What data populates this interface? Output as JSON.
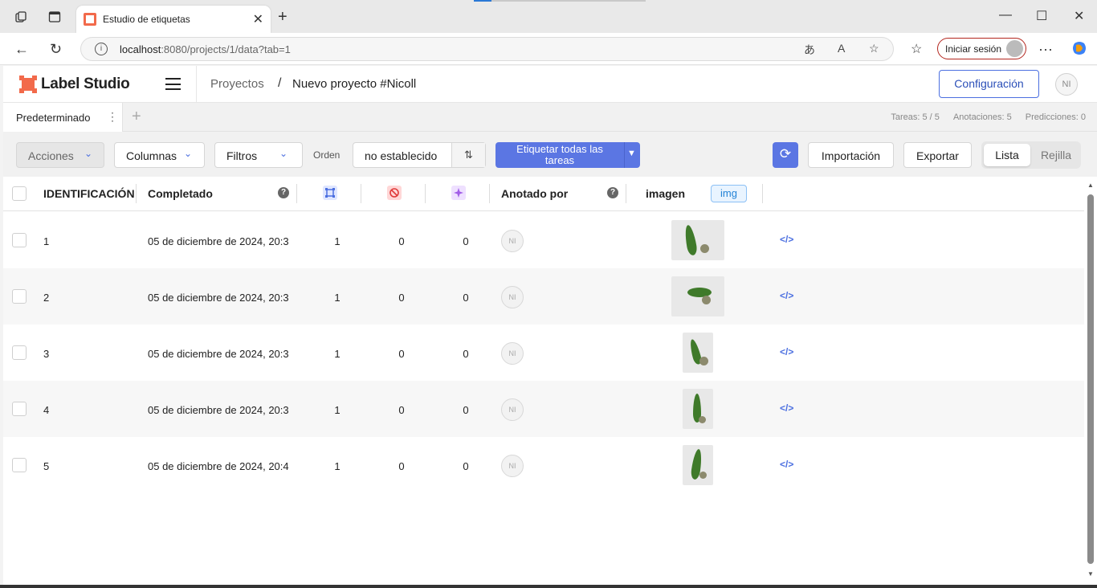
{
  "browser": {
    "tab_title": "Estudio de etiquetas",
    "url_host": "localhost",
    "url_rest": ":8080/projects/1/data?tab=1",
    "signin_label": "Iniciar sesión"
  },
  "app": {
    "logo": "Label Studio",
    "breadcrumb": [
      "Proyectos",
      "Nuevo proyecto #Nicoll"
    ],
    "config_label": "Configuración",
    "avatar_initials": "NI"
  },
  "tabs": {
    "default_tab": "Predeterminado",
    "stats": {
      "tasks": "Tareas: 5 / 5",
      "annotations": "Anotaciones: 5",
      "predictions": "Predicciones: 0"
    }
  },
  "toolbar": {
    "actions": "Acciones",
    "columns": "Columnas",
    "filters": "Filtros",
    "order_label": "Orden",
    "order_value": "no establecido",
    "label_all": "Etiquetar todas las tareas",
    "import": "Importación",
    "export": "Exportar",
    "view_list": "Lista",
    "view_grid": "Rejilla"
  },
  "table": {
    "headers": {
      "id": "IDENTIFICACIÓN",
      "completed": "Completado",
      "annotated_by": "Anotado por",
      "image": "imagen",
      "image_tag": "img"
    },
    "rows": [
      {
        "id": "1",
        "completed": "05 de diciembre de 2024, 20:3",
        "total": "1",
        "cancelled": "0",
        "predictions": "0",
        "annotator": "NI"
      },
      {
        "id": "2",
        "completed": "05 de diciembre de 2024, 20:3",
        "total": "1",
        "cancelled": "0",
        "predictions": "0",
        "annotator": "NI"
      },
      {
        "id": "3",
        "completed": "05 de diciembre de 2024, 20:3",
        "total": "1",
        "cancelled": "0",
        "predictions": "0",
        "annotator": "NI"
      },
      {
        "id": "4",
        "completed": "05 de diciembre de 2024, 20:3",
        "total": "1",
        "cancelled": "0",
        "predictions": "0",
        "annotator": "NI"
      },
      {
        "id": "5",
        "completed": "05 de diciembre de 2024, 20:4",
        "total": "1",
        "cancelled": "0",
        "predictions": "0",
        "annotator": "NI"
      }
    ]
  },
  "colors": {
    "accent": "#5b76e3",
    "brand": "#f26a4b",
    "link": "#4b6fe0"
  },
  "icons": [
    "workspaces-icon",
    "vertical-tabs-icon",
    "label-studio-logo-icon",
    "menu-icon",
    "kebab-icon",
    "add-tab-icon",
    "chevron-down-icon",
    "sort-icon",
    "refresh-icon",
    "help-icon",
    "total-annotations-icon",
    "cancelled-icon",
    "predictions-icon",
    "code-icon"
  ]
}
